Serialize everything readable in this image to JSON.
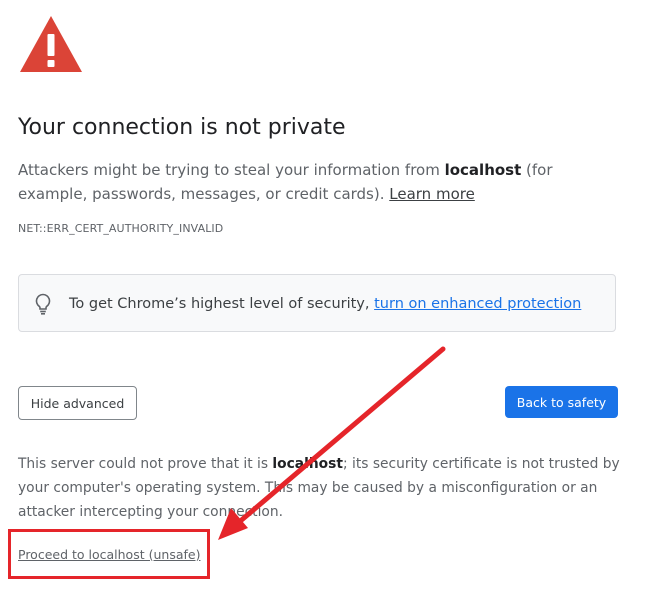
{
  "interstitial": {
    "warning_icon": "warning-triangle-icon",
    "title": "Your connection is not private",
    "intro": {
      "before": "Attackers might be trying to steal your information from ",
      "host": "localhost",
      "after": " (for example, passwords, messages, or credit cards). ",
      "learn_more": "Learn more"
    },
    "error_code": "NET::ERR_CERT_AUTHORITY_INVALID",
    "enhanced_protection": {
      "icon": "lightbulb-icon",
      "text": "To get Chrome’s highest level of security, ",
      "link": "turn on enhanced protection"
    },
    "buttons": {
      "hide_advanced": "Hide advanced",
      "back_to_safety": "Back to safety"
    },
    "details": {
      "before": "This server could not prove that it is ",
      "host": "localhost",
      "after": "; its security certificate is not trusted by your computer's operating system. This may be caused by a misconfiguration or an attacker intercepting your connection."
    },
    "proceed_link": "Proceed to localhost (unsafe)"
  },
  "annotation": {
    "color": "#e5252a",
    "arrow_icon": "arrow-icon",
    "highlight": "highlight-box"
  },
  "colors": {
    "primary_blue": "#1a73e8",
    "warning_red": "#db4437",
    "text_dark": "#202124",
    "text_gray": "#5f6368"
  }
}
